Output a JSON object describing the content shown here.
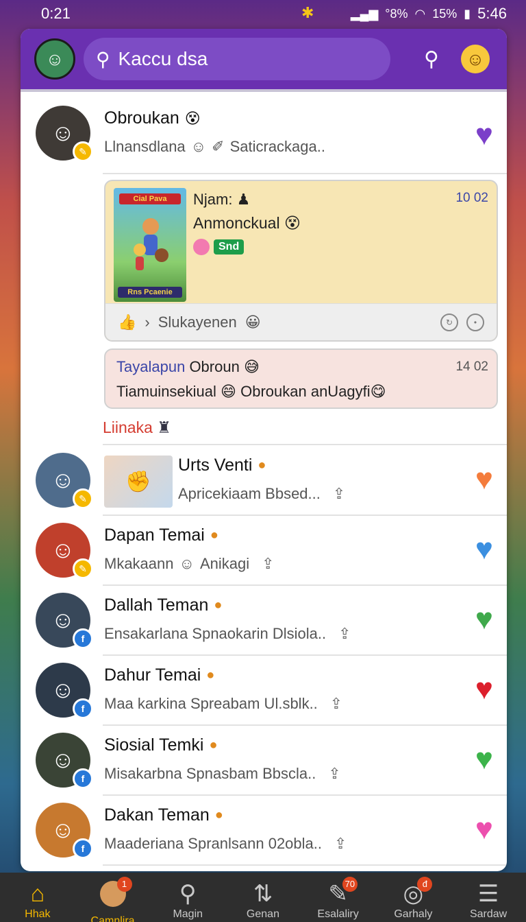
{
  "status": {
    "left_time": "0:21",
    "signal_pct": "°8%",
    "battery_pct": "15%",
    "clock": "5:46"
  },
  "header": {
    "search_text": "Kaccu dsa"
  },
  "top_post": {
    "name": "Obroukan",
    "subtitle_start": "Llnansdlana",
    "subtitle_end": "Saticrackaga..",
    "heart_color": "#7b3fc9"
  },
  "post1": {
    "thumb_top": "Cial Pava",
    "thumb_bottom": "Rns Pcaenie",
    "author": "Njam:",
    "time": "10 02",
    "title": "Anmonckual",
    "tag": "Snd",
    "footer_text": "Slukayenen"
  },
  "post2": {
    "author_link": "Tayalapun",
    "author_name": "Obroun",
    "time": "14 02",
    "body": "Tiamuinsekiual",
    "body2": "Obroukan anUagyfi"
  },
  "section_label": "Liinaka",
  "contacts": [
    {
      "name": "Urts Venti",
      "sub": "Apricekiaam Bbsed...",
      "heart": "#f47c3c",
      "pic": "#4f6c8c",
      "badge": "y"
    },
    {
      "name": "Dapan Temai",
      "sub": "Mkakaann",
      "sub2": "Anikagi",
      "heart": "#3b8fe0",
      "pic": "#c0402c",
      "badge": "y"
    },
    {
      "name": "Dallah Teman",
      "sub": "Ensakarlana Spnaokarin Dlsiola..",
      "heart": "#3fa94b",
      "pic": "#38485a",
      "badge": "b"
    },
    {
      "name": "Dahur Temai",
      "sub": "Maa karkina Spreabam Ul.sblk..",
      "heart": "#dc1f2c",
      "pic": "#2d3a4a",
      "badge": "b"
    },
    {
      "name": "Siosial Temki",
      "sub": "Misakarbna Spnasbam Bbscla..",
      "heart": "#3cb34a",
      "pic": "#3a4436",
      "badge": "b"
    },
    {
      "name": "Dakan Teman",
      "sub": "Maaderiana Spranlsann 02obla..",
      "heart": "#ec4fae",
      "pic": "#c7792f",
      "badge": "b"
    }
  ],
  "nav": [
    {
      "label": "Hhak",
      "icon": "home-icon",
      "badge": ""
    },
    {
      "label": "Camnlira",
      "icon": "avatar-icon",
      "badge": "1"
    },
    {
      "label": "Magin",
      "icon": "search-icon",
      "badge": ""
    },
    {
      "label": "Genan",
      "icon": "sort-icon",
      "badge": ""
    },
    {
      "label": "Esalaliry",
      "icon": "edit-icon",
      "badge": "70"
    },
    {
      "label": "Garhaly",
      "icon": "target-icon",
      "badge": "đ"
    },
    {
      "label": "Sardaw",
      "icon": "menu-icon",
      "badge": ""
    }
  ]
}
